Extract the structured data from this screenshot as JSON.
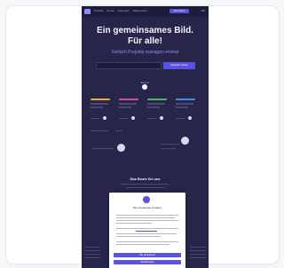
{
  "nav": {
    "links": [
      "Produkt",
      "Preise",
      "Lösungen",
      "Ressourcen"
    ],
    "cta_label": "Jetzt starten",
    "lang": "DE"
  },
  "hero": {
    "title_line1": "Ein gemeinsames Bild.",
    "title_line2": "Für alle!",
    "subtitle": "Einfach Projekte managen einmal",
    "cta_label": "Kostenlos starten"
  },
  "features": {
    "label": "Bereit?"
  },
  "section": {
    "title": "Das Beste für uns"
  },
  "consent": {
    "title": "Wir verwenden Cookies",
    "accept_label": "Alle akzeptieren",
    "more_label": "Einstellungen"
  },
  "colors": {
    "bar_colors": [
      "#e0b12f",
      "#d14d8e",
      "#4fb46a",
      "#3e8fd9",
      "#a05ad8"
    ]
  }
}
